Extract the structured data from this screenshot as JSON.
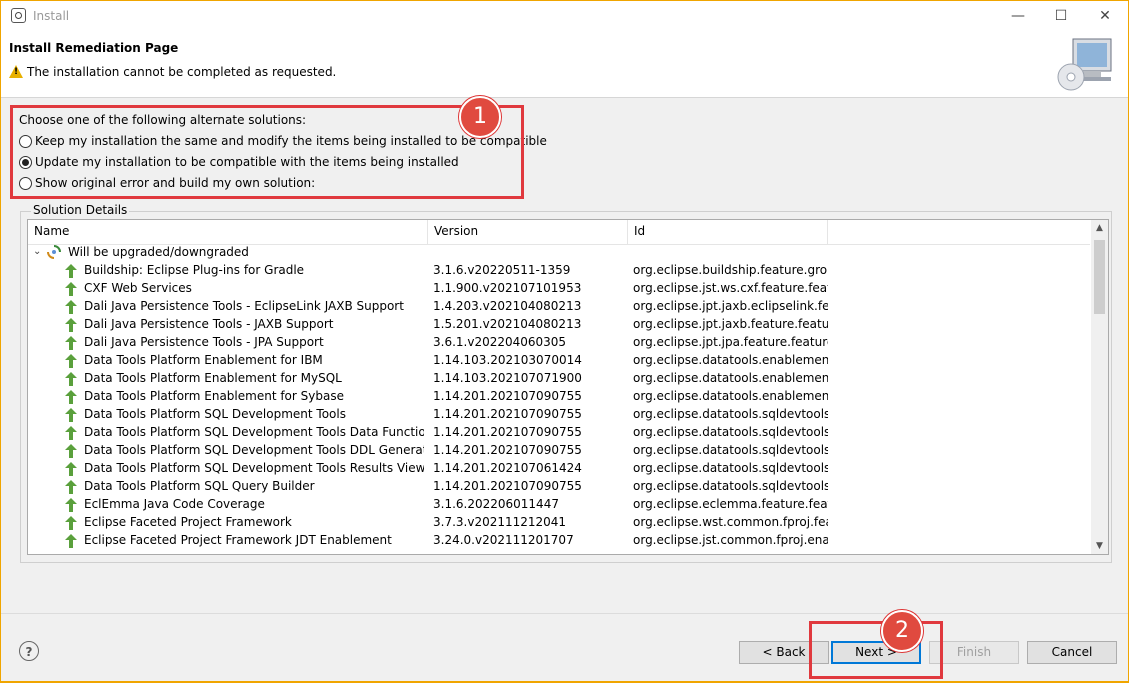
{
  "window": {
    "title": "Install"
  },
  "header": {
    "title": "Install Remediation Page",
    "message": "The installation cannot be completed as requested."
  },
  "options": {
    "prompt": "Choose one of the following alternate solutions:",
    "items": [
      {
        "label": "Keep my installation the same and modify the items being installed to be compatible",
        "selected": false
      },
      {
        "label": "Update my installation to be compatible with the items being installed",
        "selected": true
      },
      {
        "label": "Show original error and build my own solution:",
        "selected": false
      }
    ]
  },
  "details": {
    "group_label": "Solution Details",
    "columns": [
      "Name",
      "Version",
      "Id"
    ],
    "group_row": "Will be upgraded/downgraded",
    "rows": [
      {
        "name": "Buildship: Eclipse Plug-ins for Gradle",
        "version": "3.1.6.v20220511-1359",
        "id": "org.eclipse.buildship.feature.group"
      },
      {
        "name": "CXF Web Services",
        "version": "1.1.900.v202107101953",
        "id": "org.eclipse.jst.ws.cxf.feature.featur"
      },
      {
        "name": "Dali Java Persistence Tools - EclipseLink JAXB Support",
        "version": "1.4.203.v202104080213",
        "id": "org.eclipse.jpt.jaxb.eclipselink.feat..."
      },
      {
        "name": "Dali Java Persistence Tools - JAXB Support",
        "version": "1.5.201.v202104080213",
        "id": "org.eclipse.jpt.jaxb.feature.feature...."
      },
      {
        "name": "Dali Java Persistence Tools - JPA Support",
        "version": "3.6.1.v202204060305",
        "id": "org.eclipse.jpt.jpa.feature.feature.g..."
      },
      {
        "name": "Data Tools Platform Enablement for IBM",
        "version": "1.14.103.202103070014",
        "id": "org.eclipse.datatools.enablement.i..."
      },
      {
        "name": "Data Tools Platform Enablement for MySQL",
        "version": "1.14.103.202107071900",
        "id": "org.eclipse.datatools.enablement...."
      },
      {
        "name": "Data Tools Platform Enablement for Sybase",
        "version": "1.14.201.202107090755",
        "id": "org.eclipse.datatools.enablement.s..."
      },
      {
        "name": "Data Tools Platform SQL Development Tools",
        "version": "1.14.201.202107090755",
        "id": "org.eclipse.datatools.sqldevtools.f..."
      },
      {
        "name": "Data Tools Platform SQL Development Tools Data Functions",
        "version": "1.14.201.202107090755",
        "id": "org.eclipse.datatools.sqldevtools.d..."
      },
      {
        "name": "Data Tools Platform SQL Development Tools DDL Generation Fe",
        "version": "1.14.201.202107090755",
        "id": "org.eclipse.datatools.sqldevtools.d..."
      },
      {
        "name": "Data Tools Platform SQL Development Tools Results View",
        "version": "1.14.201.202107061424",
        "id": "org.eclipse.datatools.sqldevtools.r..."
      },
      {
        "name": "Data Tools Platform SQL Query Builder",
        "version": "1.14.201.202107090755",
        "id": "org.eclipse.datatools.sqldevtools.s..."
      },
      {
        "name": "EclEmma Java Code Coverage",
        "version": "3.1.6.202206011447",
        "id": "org.eclipse.eclemma.feature.featur..."
      },
      {
        "name": "Eclipse Faceted Project Framework",
        "version": "3.7.3.v202111212041",
        "id": "org.eclipse.wst.common.fproj.feat..."
      },
      {
        "name": "Eclipse Faceted Project Framework JDT Enablement",
        "version": "3.24.0.v202111201707",
        "id": "org.eclipse.jst.common.fproj.enab..."
      }
    ]
  },
  "buttons": {
    "help": "?",
    "back": "< Back",
    "next": "Next >",
    "finish": "Finish",
    "cancel": "Cancel"
  },
  "annotations": {
    "badge1": "1",
    "badge2": "2",
    "color": "#e0393e"
  }
}
